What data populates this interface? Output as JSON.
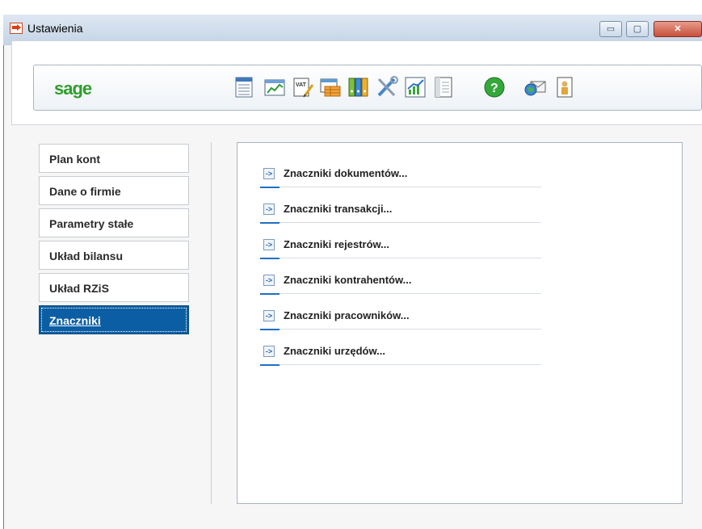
{
  "window": {
    "title": "Ustawienia",
    "controls": {
      "minimize": "▭",
      "maximize": "▢",
      "close": "✕"
    }
  },
  "header": {
    "logo": "sage",
    "toolbar_icons": [
      "chart-of-accounts-icon",
      "financial-report-icon",
      "vat-document-icon",
      "register-icon",
      "binders-icon",
      "tools-icon",
      "growth-chart-icon",
      "ledger-icon",
      "help-icon",
      "mail-globe-icon",
      "user-card-icon"
    ]
  },
  "nav": {
    "items": [
      {
        "label": "Plan kont",
        "active": false
      },
      {
        "label": "Dane o firmie",
        "active": false
      },
      {
        "label": "Parametry stałe",
        "active": false
      },
      {
        "label": "Układ bilansu",
        "active": false
      },
      {
        "label": "Układ RZiS",
        "active": false
      },
      {
        "label": "Znaczniki",
        "active": true
      }
    ]
  },
  "content": {
    "links": [
      "Znaczniki dokumentów...",
      "Znaczniki transakcji...",
      "Znaczniki rejestrów...",
      "Znaczniki kontrahentów...",
      "Znaczniki pracowników...",
      "Znaczniki urzędów..."
    ],
    "link_glyph": "->"
  },
  "colors": {
    "active_nav": "#0b5ea3",
    "logo": "#2e9e2c",
    "link_accent": "#1f6fc0"
  }
}
